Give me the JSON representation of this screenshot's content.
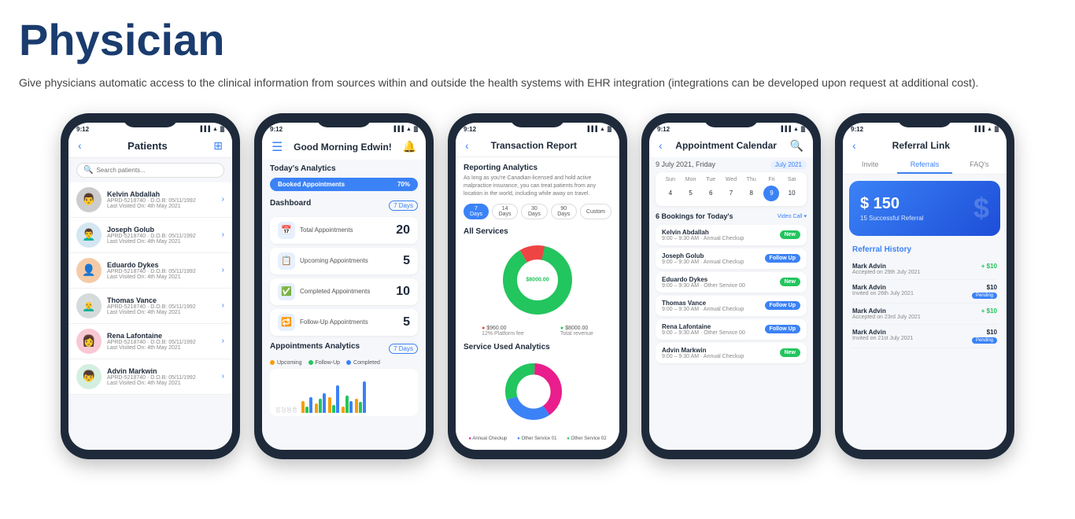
{
  "header": {
    "title": "Physician",
    "description": "Give physicians automatic access to the clinical information from sources within and outside the health systems with EHR integration (integrations can be developed upon request at additional cost)."
  },
  "phones": [
    {
      "id": "phone1",
      "name": "Patients List",
      "status_time": "9:12",
      "header_title": "Patients",
      "search_placeholder": "Search patients...",
      "patients": [
        {
          "name": "Kelvin Abdallah",
          "aprid": "APRD-5218740",
          "dob": "D.O.B: 05/11/1992",
          "last_visited": "Last Visited On: 4th May 2021",
          "avatar": "👨"
        },
        {
          "name": "Joseph Golub",
          "aprid": "APRD-5218740",
          "dob": "D.O.B: 05/11/1992",
          "last_visited": "Last Visited On: 4th May 2021",
          "avatar": "👨‍🦱"
        },
        {
          "name": "Eduardo Dykes",
          "aprid": "APRD-5218740",
          "dob": "D.O.B: 05/11/1992",
          "last_visited": "Last Visited On: 4th May 2021",
          "avatar": "👤"
        },
        {
          "name": "Thomas Vance",
          "aprid": "APRD-5218740",
          "dob": "D.O.B: 05/11/1992",
          "last_visited": "Last Visited On: 4th May 2021",
          "avatar": "👨‍🦳"
        },
        {
          "name": "Rena Lafontaine",
          "aprid": "APRD-5218740",
          "dob": "D.O.B: 05/11/1992",
          "last_visited": "Last Visited On: 4th May 2021",
          "avatar": "👩"
        },
        {
          "name": "Advin Markwin",
          "aprid": "APRD-5218740",
          "dob": "D.O.B: 05/11/1992",
          "last_visited": "Last Visited On: 4th May 2021",
          "avatar": "👦"
        }
      ]
    },
    {
      "id": "phone2",
      "name": "Dashboard",
      "status_time": "9:12",
      "greeting": "Good Morning Edwin!",
      "todays_analytics_title": "Today's Analytics",
      "booked_appointments_label": "Booked Appointments",
      "booked_percent": "70%",
      "dashboard_title": "Dashboard",
      "days_label": "7 Days",
      "stats": [
        {
          "icon": "📅",
          "label": "Total Appointments",
          "value": "20"
        },
        {
          "icon": "📋",
          "label": "Upcoming Appointments",
          "value": "5"
        },
        {
          "icon": "✅",
          "label": "Completed Appointments",
          "value": "10"
        },
        {
          "icon": "🔁",
          "label": "Follow-Up Appointments",
          "value": "5"
        }
      ],
      "analytics_title": "Appointments Analytics",
      "analytics_days": "7 Days",
      "legend": [
        {
          "label": "Upcoming",
          "color": "#f59e0b"
        },
        {
          "label": "Follow-Up",
          "color": "#22c55e"
        },
        {
          "label": "Completed",
          "color": "#3b82f6"
        }
      ]
    },
    {
      "id": "phone3",
      "name": "Transaction Report",
      "status_time": "9:12",
      "header_title": "Transaction Report",
      "reporting_title": "Reporting Analytics",
      "reporting_desc": "As long as you're Canadian-licensed and hold active malpractice insurance, you can treat patients from any location in the world, including while away on travel.",
      "filters": [
        "7 Days",
        "14 Days",
        "30 Days",
        "90 Days",
        "Custom"
      ],
      "active_filter": "7 Days",
      "all_services_title": "All Services",
      "donut1": {
        "segments": [
          {
            "label": "$960.00\n12% Platform fee amount",
            "color": "#ef4444",
            "percent": 12
          },
          {
            "label": "$8000.00\nTotal revenue amount",
            "color": "#22c55e",
            "percent": 88
          }
        ]
      },
      "service_analytics_title": "Service Used Analytics",
      "donut2": {
        "segments": [
          {
            "label": "Annual Checkup",
            "color": "#e91e8c",
            "percent": 40
          },
          {
            "label": "Other Service 01",
            "color": "#3b82f6",
            "percent": 30
          },
          {
            "label": "30%",
            "color": "#22c55e",
            "percent": 30
          }
        ]
      }
    },
    {
      "id": "phone4",
      "name": "Appointment Calendar",
      "status_time": "9:12",
      "header_title": "Appointment Calendar",
      "date_label": "9 July 2021, Friday",
      "month_badge": "July 2021",
      "calendar_days_header": [
        "Sun",
        "Mon",
        "Tue",
        "Wed",
        "Thu",
        "Fri",
        "Sat"
      ],
      "calendar_days": [
        "4",
        "5",
        "6",
        "7",
        "8",
        "9",
        "10"
      ],
      "active_day": "9",
      "bookings_title": "6 Bookings for Today's",
      "video_label": "Video Call",
      "bookings": [
        {
          "name": "Kelvin Abdallah",
          "time": "9:00 – 9:30 AM · Annual Checkup",
          "status": "New",
          "status_type": "new"
        },
        {
          "name": "Joseph Golub",
          "time": "9:00 – 9:30 AM · Annual Checkup",
          "status": "Follow Up",
          "status_type": "followup"
        },
        {
          "name": "Eduardo Dykes",
          "time": "9:00 – 9:30 AM · Other Service 00",
          "status": "New",
          "status_type": "new"
        },
        {
          "name": "Thomas Vance",
          "time": "9:00 – 9:30 AM · Annual Checkup",
          "status": "Follow Up",
          "status_type": "followup"
        },
        {
          "name": "Rena Lafontaine",
          "time": "9:00 – 9:30 AM · Other Service 00",
          "status": "Follow Up",
          "status_type": "followup"
        },
        {
          "name": "Advin Markwin",
          "time": "9:00 – 9:30 AM · Annual Checkup",
          "status": "New",
          "status_type": "new"
        }
      ]
    },
    {
      "id": "phone5",
      "name": "Referral Link",
      "status_time": "9:12",
      "header_title": "Referral Link",
      "tabs": [
        "Invite",
        "Referrals",
        "FAQ's"
      ],
      "active_tab": "Referrals",
      "banner_amount": "$ 150",
      "banner_sub": "15 Successful Referral",
      "history_title": "Referral History",
      "history_items": [
        {
          "name": "Mark Advin",
          "date": "Accepted on 29th July 2021",
          "amount": "+ $10",
          "type": "positive"
        },
        {
          "name": "Mark Advin",
          "date": "Invited on 26th July 2021",
          "pending_amount": "$10",
          "type": "pending"
        },
        {
          "name": "Mark Advin",
          "date": "Accepted on 23rd July 2021",
          "amount": "+ $10",
          "type": "positive"
        },
        {
          "name": "Mark Advin",
          "date": "Invited on 21st July 2021",
          "pending_amount": "$10",
          "type": "pending"
        }
      ]
    }
  ]
}
